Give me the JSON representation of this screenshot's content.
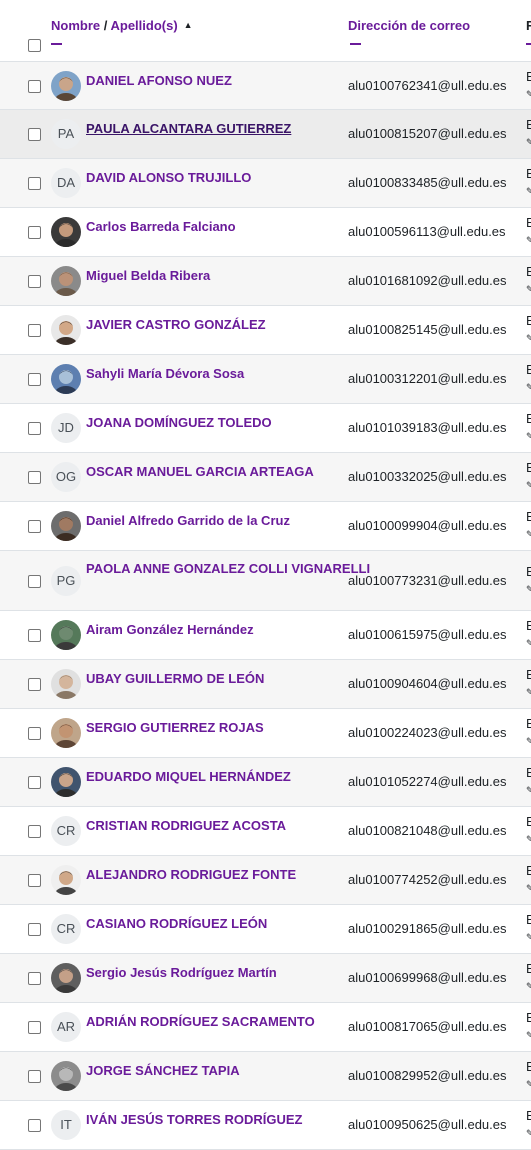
{
  "header": {
    "name_col_first": "Nombre",
    "name_col_sep": " / ",
    "name_col_second": "Apellido(s)",
    "sort_icon": "▲",
    "email_col": "Dirección de correo",
    "extra_col": "F"
  },
  "colors": {
    "accent": "#6a1b9a",
    "row_stripe": "#f6f6f6",
    "border": "#dee2e6"
  },
  "rows": [
    {
      "name": "DANIEL AFONSO NUEZ",
      "email": "alu0100762341@ull.edu.es",
      "avatar": "photo",
      "initials": "",
      "extra": "E",
      "pen": "✎"
    },
    {
      "name": "PAULA ALCANTARA GUTIERREZ",
      "email": "alu0100815207@ull.edu.es",
      "avatar": "initials",
      "initials": "PA",
      "extra": "E",
      "pen": "✎"
    },
    {
      "name": "DAVID ALONSO TRUJILLO",
      "email": "alu0100833485@ull.edu.es",
      "avatar": "initials",
      "initials": "DA",
      "extra": "E",
      "pen": "✎"
    },
    {
      "name": "Carlos Barreda Falciano",
      "email": "alu0100596113@ull.edu.es",
      "avatar": "photo",
      "initials": "",
      "extra": "E",
      "pen": "✎"
    },
    {
      "name": "Miguel Belda Ribera",
      "email": "alu0101681092@ull.edu.es",
      "avatar": "photo",
      "initials": "",
      "extra": "E",
      "pen": "✎"
    },
    {
      "name": "JAVIER CASTRO GONZÁLEZ",
      "email": "alu0100825145@ull.edu.es",
      "avatar": "photo",
      "initials": "",
      "extra": "E",
      "pen": "✎"
    },
    {
      "name": "Sahyli María Dévora Sosa",
      "email": "alu0100312201@ull.edu.es",
      "avatar": "photo",
      "initials": "",
      "extra": "E",
      "pen": "✎"
    },
    {
      "name": "JOANA DOMÍNGUEZ TOLEDO",
      "email": "alu0101039183@ull.edu.es",
      "avatar": "initials",
      "initials": "JD",
      "extra": "E",
      "pen": "✎"
    },
    {
      "name": "OSCAR MANUEL GARCIA ARTEAGA",
      "email": "alu0100332025@ull.edu.es",
      "avatar": "initials",
      "initials": "OG",
      "extra": "E",
      "pen": "✎"
    },
    {
      "name": "Daniel Alfredo Garrido de la Cruz",
      "email": "alu0100099904@ull.edu.es",
      "avatar": "photo",
      "initials": "",
      "extra": "E",
      "pen": "✎"
    },
    {
      "name": "PAOLA ANNE GONZALEZ COLLI VIGNARELLI",
      "email": "alu0100773231@ull.edu.es",
      "avatar": "initials",
      "initials": "PG",
      "extra": "E",
      "pen": "✎"
    },
    {
      "name": "Airam González Hernández",
      "email": "alu0100615975@ull.edu.es",
      "avatar": "photo",
      "initials": "",
      "extra": "E",
      "pen": "✎"
    },
    {
      "name": "UBAY GUILLERMO DE LEÓN",
      "email": "alu0100904604@ull.edu.es",
      "avatar": "photo",
      "initials": "",
      "extra": "E",
      "pen": "✎"
    },
    {
      "name": "SERGIO GUTIERREZ ROJAS",
      "email": "alu0100224023@ull.edu.es",
      "avatar": "photo",
      "initials": "",
      "extra": "E",
      "pen": "✎"
    },
    {
      "name": "EDUARDO MIQUEL HERNÁNDEZ",
      "email": "alu0101052274@ull.edu.es",
      "avatar": "photo",
      "initials": "",
      "extra": "E",
      "pen": "✎"
    },
    {
      "name": "CRISTIAN RODRIGUEZ ACOSTA",
      "email": "alu0100821048@ull.edu.es",
      "avatar": "initials",
      "initials": "CR",
      "extra": "E",
      "pen": "✎"
    },
    {
      "name": "ALEJANDRO RODRIGUEZ FONTE",
      "email": "alu0100774252@ull.edu.es",
      "avatar": "photo",
      "initials": "",
      "extra": "E",
      "pen": "✎"
    },
    {
      "name": "CASIANO RODRÍGUEZ LEÓN",
      "email": "alu0100291865@ull.edu.es",
      "avatar": "initials",
      "initials": "CR",
      "extra": "E",
      "pen": "✎"
    },
    {
      "name": "Sergio Jesús Rodríguez Martín",
      "email": "alu0100699968@ull.edu.es",
      "avatar": "photo",
      "initials": "",
      "extra": "E",
      "pen": "✎"
    },
    {
      "name": "ADRIÁN RODRÍGUEZ SACRAMENTO",
      "email": "alu0100817065@ull.edu.es",
      "avatar": "initials",
      "initials": "AR",
      "extra": "E",
      "pen": "✎"
    },
    {
      "name": "JORGE SÁNCHEZ TAPIA",
      "email": "alu0100829952@ull.edu.es",
      "avatar": "photo",
      "initials": "",
      "extra": "E",
      "pen": "✎"
    },
    {
      "name": "IVÁN JESÚS TORRES RODRÍGUEZ",
      "email": "alu0100950625@ull.edu.es",
      "avatar": "initials",
      "initials": "IT",
      "extra": "E",
      "pen": "✎"
    }
  ]
}
